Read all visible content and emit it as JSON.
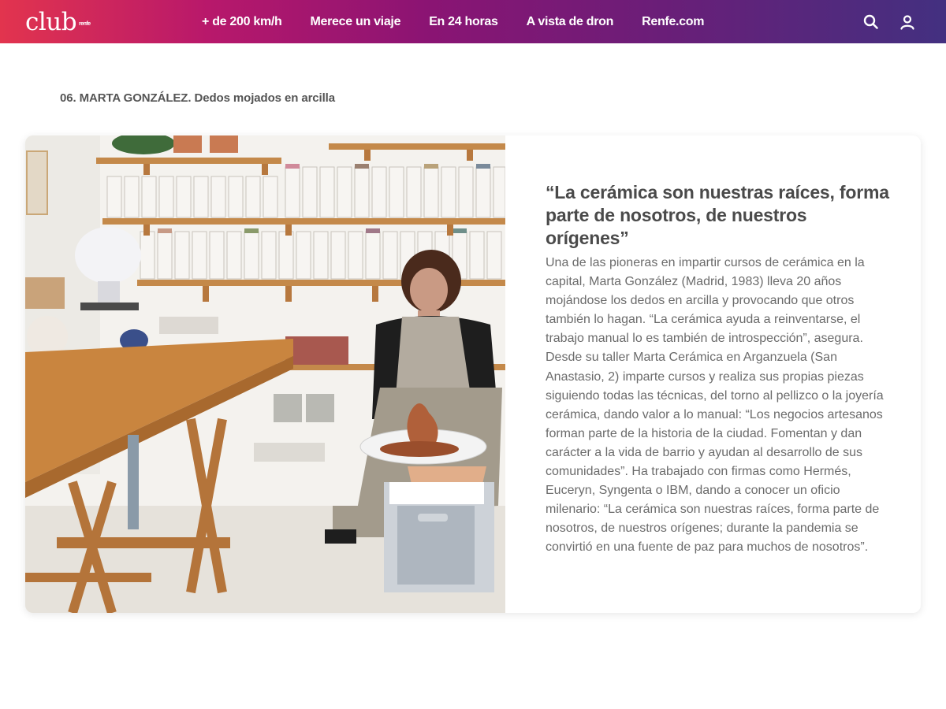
{
  "header": {
    "logo": "club",
    "logo_sup": "renfe",
    "nav": [
      "+ de 200 km/h",
      "Merece un viaje",
      "En 24 horas",
      "A vista de dron",
      "Renfe.com"
    ]
  },
  "article": {
    "section_title": "06. MARTA GONZÁLEZ. Dedos mojados en arcilla",
    "quote": "“La cerámica son nuestras raíces, forma parte de nosotros, de nuestros orígenes”",
    "body": "Una de las pioneras en impartir cursos de cerámica en la capital, Marta González (Madrid, 1983) lleva 20 años mojándose los dedos en arcilla y provocando que otros también lo hagan. “La cerámica ayuda a reinventarse, el trabajo manual lo es también de introspección”, asegura. Desde su taller Marta Cerámica en Arganzuela (San Anastasio, 2) imparte cursos y realiza sus propias piezas siguiendo todas las técnicas, del torno al pellizco o la joyería cerámica, dando valor a lo manual: “Los negocios artesanos forman parte de la historia de la ciudad. Fomentan y dan carácter a la vida de barrio y ayudan al desarrollo de sus comunidades”. Ha trabajado con firmas como Hermés, Euceryn, Syngenta o IBM, dando a conocer un oficio milenario: “La cerámica son nuestras raíces, forma parte de nosotros, de nuestros orígenes; durante la pandemia se convirtió en una fuente de paz para muchos de nosotros”."
  },
  "icons": {
    "search": "search-icon",
    "user": "user-icon"
  }
}
